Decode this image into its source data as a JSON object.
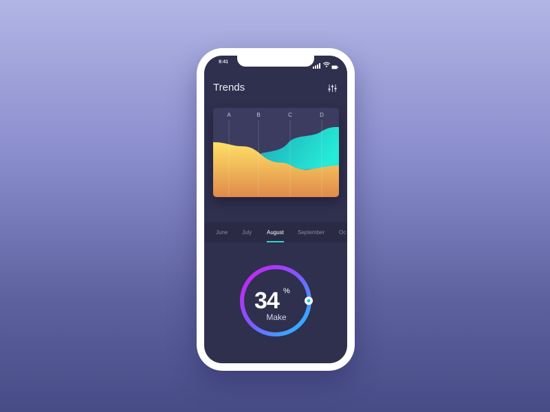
{
  "status_bar": {
    "time": "9:41"
  },
  "header": {
    "title": "Trends",
    "filter_icon": "sliders-icon"
  },
  "chart_data": {
    "type": "area",
    "markers": [
      "A",
      "B",
      "C",
      "D"
    ],
    "series": [
      {
        "colors": [
          "#ffe066",
          "#e08a4a"
        ]
      },
      {
        "colors": [
          "#25ead6",
          "#1fb8c4"
        ]
      }
    ],
    "grid": true
  },
  "months": {
    "items": [
      "June",
      "July",
      "August",
      "September",
      "Oc"
    ],
    "selected": "August",
    "accent": "#33d6d0"
  },
  "gauge": {
    "value": "34",
    "unit": "%",
    "label": "Make",
    "fraction": 0.34,
    "colors": [
      "#d31bf0",
      "#1cc8ff"
    ]
  }
}
